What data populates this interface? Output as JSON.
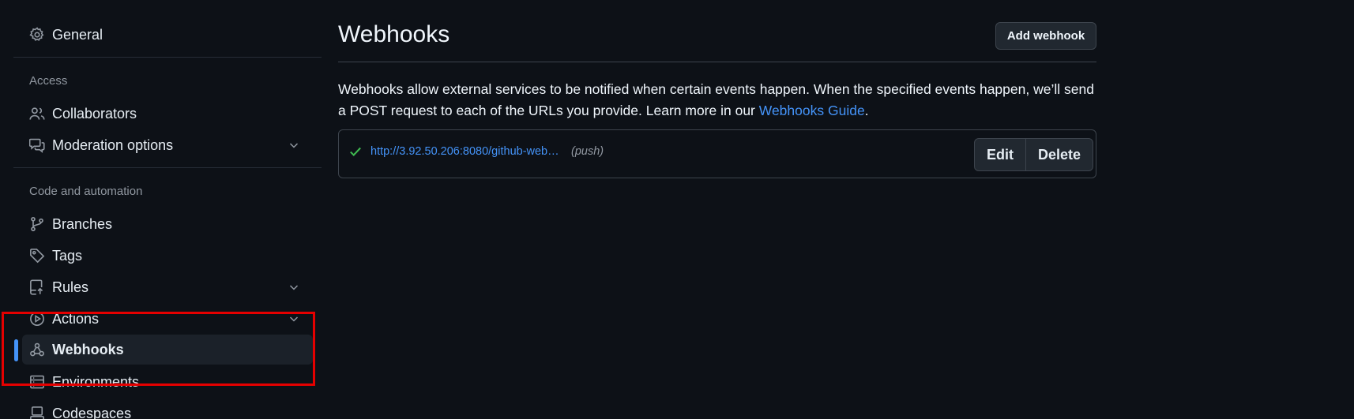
{
  "sidebar": {
    "general": {
      "label": "General",
      "icon": "gear-icon"
    },
    "access_heading": "Access",
    "collaborators": {
      "label": "Collaborators",
      "icon": "people-icon"
    },
    "moderation": {
      "label": "Moderation options",
      "icon": "comment-discussion-icon"
    },
    "code_heading": "Code and automation",
    "branches": {
      "label": "Branches",
      "icon": "git-branch-icon"
    },
    "tags": {
      "label": "Tags",
      "icon": "tag-icon"
    },
    "rules": {
      "label": "Rules",
      "icon": "repo-push-icon"
    },
    "actions": {
      "label": "Actions",
      "icon": "play-icon"
    },
    "webhooks": {
      "label": "Webhooks",
      "icon": "webhook-icon"
    },
    "environments": {
      "label": "Environments",
      "icon": "server-icon"
    },
    "codespaces": {
      "label": "Codespaces",
      "icon": "codespaces-icon"
    }
  },
  "main": {
    "title": "Webhooks",
    "add_button": "Add webhook",
    "description_text": "Webhooks allow external services to be notified when certain events happen. When the specified events happen, we’ll send a POST request to each of the URLs you provide. Learn more in our ",
    "guide_link": "Webhooks Guide",
    "description_end": ".",
    "hook": {
      "url": "http://3.92.50.206:8080/github-web…",
      "event": "(push)",
      "edit": "Edit",
      "delete": "Delete"
    }
  },
  "colors": {
    "accent": "#4493f8",
    "success": "#3fb950",
    "highlight_box": "#e50000"
  }
}
